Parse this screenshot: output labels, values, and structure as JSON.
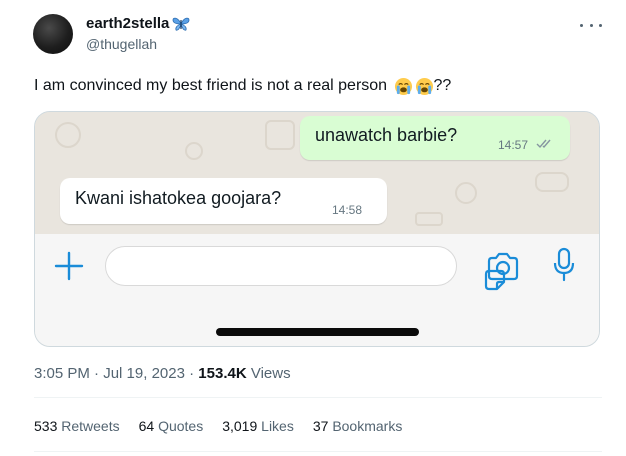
{
  "author": {
    "display_name": "earth2stella",
    "handle": "@thugellah",
    "badge_icon": "butterfly-icon"
  },
  "tweet": {
    "text": "I am convinced my best friend is not a real person",
    "emojis": [
      "loudly-crying-face-icon",
      "loudly-crying-face-icon"
    ],
    "suffix": "??"
  },
  "chat": {
    "outgoing": {
      "text": "unawatch barbie?",
      "time": "14:57",
      "status_icon": "double-check-icon"
    },
    "incoming": {
      "text": "Kwani ishatokea goojara?",
      "time": "14:58"
    },
    "composer": {
      "placeholder": "",
      "icons": [
        "plus-icon",
        "sticker-icon",
        "camera-icon",
        "microphone-icon"
      ]
    },
    "colors": {
      "outgoing_bubble": "#d9fdd3",
      "accent": "#1a8cd8",
      "background": "#e9e5de"
    }
  },
  "meta": {
    "time": "3:05 PM",
    "separator": "·",
    "date": "Jul 19, 2023",
    "views_count": "153.4K",
    "views_label": "Views"
  },
  "stats": {
    "retweets": {
      "count": "533",
      "label": "Retweets"
    },
    "quotes": {
      "count": "64",
      "label": "Quotes"
    },
    "likes": {
      "count": "3,019",
      "label": "Likes"
    },
    "bookmarks": {
      "count": "37",
      "label": "Bookmarks"
    }
  }
}
